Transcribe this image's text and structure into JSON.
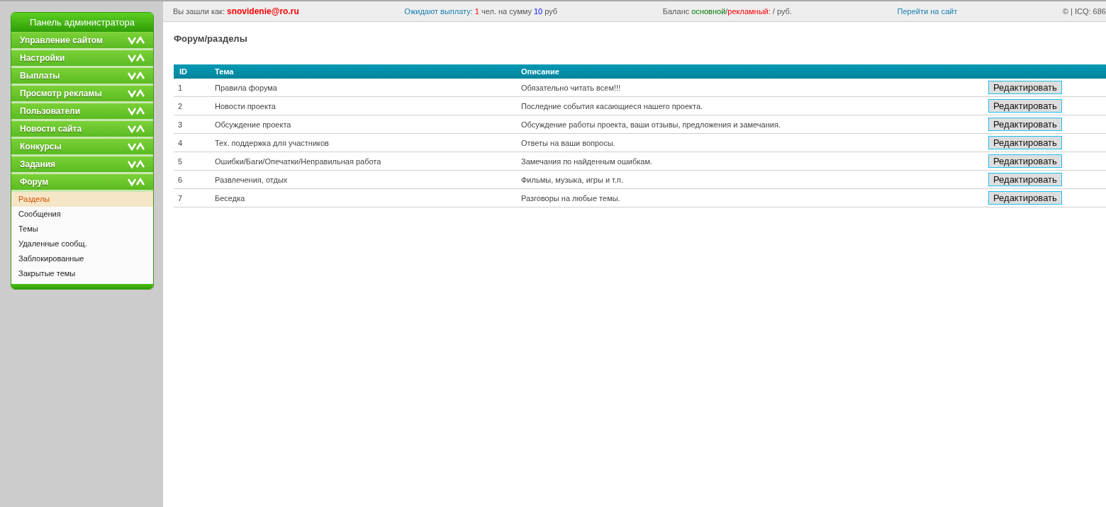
{
  "sidebar": {
    "title": "Панель администратора",
    "items": [
      {
        "label": "Управление сайтом"
      },
      {
        "label": "Настройки"
      },
      {
        "label": "Выплаты"
      },
      {
        "label": "Просмотр рекламы"
      },
      {
        "label": "Пользователи"
      },
      {
        "label": "Новости сайта"
      },
      {
        "label": "Конкурсы"
      },
      {
        "label": "Задания"
      },
      {
        "label": "Форум",
        "children": [
          {
            "label": "Разделы",
            "selected": true
          },
          {
            "label": "Сообщения",
            "selected": false
          },
          {
            "label": "Темы",
            "selected": false
          },
          {
            "label": "Удаленные сообщ.",
            "selected": false
          },
          {
            "label": "Заблокированные",
            "selected": false
          },
          {
            "label": "Закрытые темы",
            "selected": false
          }
        ]
      }
    ]
  },
  "top_bar": {
    "info": [
      {
        "parts": [
          {
            "text": "Вы зашли как: ",
            "kind": "plain"
          },
          {
            "text": "snovidenie@ro.ru",
            "kind": "user"
          }
        ]
      },
      {
        "parts": [
          {
            "text": "Ожидают выплату: ",
            "kind": "accent"
          },
          {
            "text": "1",
            "kind": "red"
          },
          {
            "text": " чел. на сумму ",
            "kind": "plain"
          },
          {
            "text": "10",
            "kind": "blue"
          },
          {
            "text": " руб",
            "kind": "plain"
          }
        ]
      },
      {
        "parts": [
          {
            "text": "Баланс ",
            "kind": "plain"
          },
          {
            "text": "основной",
            "kind": "green"
          },
          {
            "text": "/",
            "kind": "plain"
          },
          {
            "text": "рекламный:",
            "kind": "red"
          },
          {
            "text": " / руб.",
            "kind": "plain"
          }
        ]
      }
    ],
    "site_link": "Перейти на сайт",
    "copyright": "© | ICQ: 686"
  },
  "page_title": "Форум/разделы",
  "table": {
    "columns": [
      "ID",
      "Тема",
      "Описание"
    ],
    "rows": [
      {
        "id": "1",
        "topic": "Правила форума",
        "description": "Обязательно читать всем!!!",
        "action": "Редактировать"
      },
      {
        "id": "2",
        "topic": "Новости проекта",
        "description": "Последние события касающиеся нашего проекта.",
        "action": "Редактировать"
      },
      {
        "id": "3",
        "topic": "Обсуждение проекта",
        "description": "Обсуждение работы проекта, ваши отзывы, предложения и замечания.",
        "action": "Редактировать"
      },
      {
        "id": "4",
        "topic": "Тех. поддержка для участников",
        "description": "Ответы на ваши вопросы.",
        "action": "Редактировать"
      },
      {
        "id": "5",
        "topic": "Ошибки/Баги/Опечатки/Неправильная работа",
        "description": "Замечания по найденным ошибкам.",
        "action": "Редактировать"
      },
      {
        "id": "6",
        "topic": "Развлечения, отдых",
        "description": "Фильмы, музыка, игры и т.п.",
        "action": "Редактировать"
      },
      {
        "id": "7",
        "topic": "Беседка",
        "description": "Разговоры на любые темы.",
        "action": "Редактировать"
      }
    ]
  }
}
